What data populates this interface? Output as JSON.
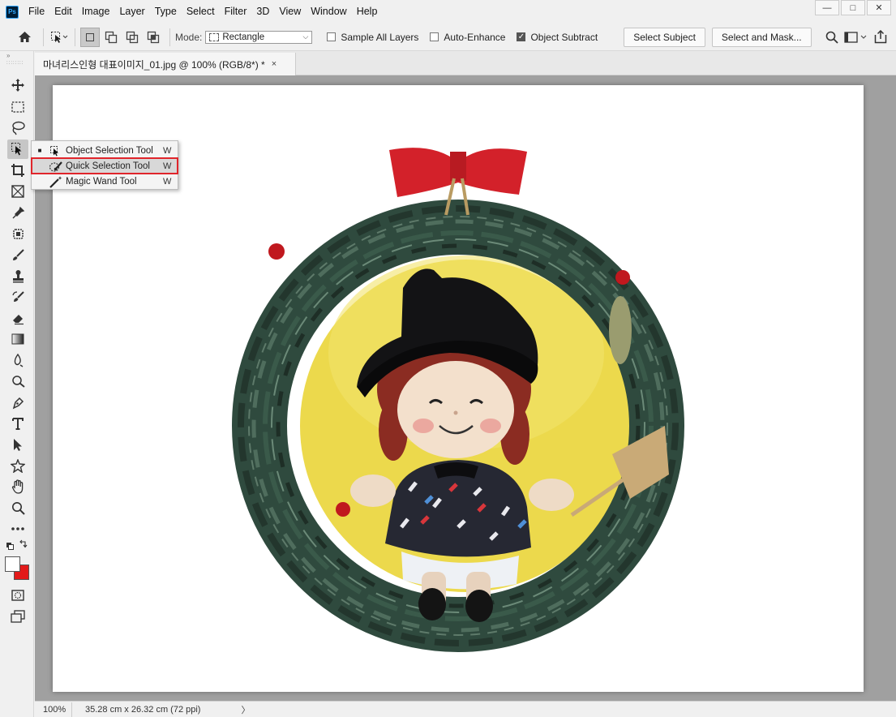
{
  "app": {
    "logo_text": "Ps"
  },
  "menu": [
    "File",
    "Edit",
    "Image",
    "Layer",
    "Type",
    "Select",
    "Filter",
    "3D",
    "View",
    "Window",
    "Help"
  ],
  "window_controls": {
    "minimize": "—",
    "maximize": "□",
    "close": "✕"
  },
  "options_bar": {
    "mode_label": "Mode:",
    "mode_value": "Rectangle",
    "sample_all_layers": {
      "label": "Sample All Layers",
      "checked": false
    },
    "auto_enhance": {
      "label": "Auto-Enhance",
      "checked": false
    },
    "object_subtract": {
      "label": "Object Subtract",
      "checked": true
    },
    "select_subject_label": "Select Subject",
    "select_and_mask_label": "Select and Mask..."
  },
  "document_tab": {
    "title": "마녀리스인형 대표이미지_01.jpg @ 100% (RGB/8*) *",
    "close": "×"
  },
  "flyout": {
    "items": [
      {
        "label": "Object Selection Tool",
        "shortcut": "W",
        "current": true,
        "highlighted": false
      },
      {
        "label": "Quick Selection Tool",
        "shortcut": "W",
        "current": false,
        "highlighted": true
      },
      {
        "label": "Magic Wand Tool",
        "shortcut": "W",
        "current": false,
        "highlighted": false
      }
    ]
  },
  "status": {
    "zoom": "100%",
    "info": "35.28 cm x 26.32 cm (72 ppi)",
    "arrow": "〉"
  },
  "colors": {
    "foreground": "#ffffff",
    "background": "#e21a1a",
    "highlight_outline": "#e0252b"
  }
}
